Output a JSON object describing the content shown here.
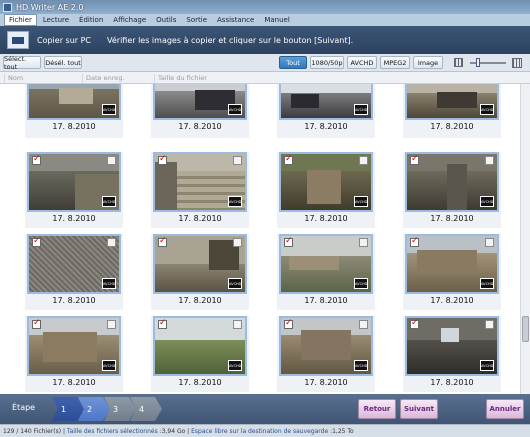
{
  "window": {
    "title": "HD Writer AE 2.0"
  },
  "menu": [
    "Fichier",
    "Lecture",
    "Édition",
    "Affichage",
    "Outils",
    "Sortie",
    "Assistance",
    "Manuel"
  ],
  "header": {
    "title": "Copier sur PC",
    "message": "Vérifier les images à copier et cliquer sur le bouton [Suivant]."
  },
  "toolbar": {
    "select_all": "Sélect. tout",
    "deselect_all": "Désél. tout",
    "filters": [
      "Tout",
      "1080/50p",
      "AVCHD",
      "MPEG2",
      "Image"
    ],
    "selected_filter": "Tout"
  },
  "columns": [
    "Nom",
    "Date enreg.",
    "Taille du fichier"
  ],
  "tiles": [
    {
      "date": "17. 8.2010",
      "checked": true,
      "badge": "AVCHD"
    },
    {
      "date": "17. 8.2010",
      "checked": true,
      "badge": "AVCHD"
    },
    {
      "date": "17. 8.2010",
      "checked": true,
      "badge": "AVCHD"
    },
    {
      "date": "17. 8.2010",
      "checked": true,
      "badge": "AVCHD"
    },
    {
      "date": "17. 8.2010",
      "checked": true,
      "badge": "AVCHD"
    },
    {
      "date": "17. 8.2010",
      "checked": true,
      "badge": "AVCHD"
    },
    {
      "date": "17. 8.2010",
      "checked": true,
      "badge": "AVCHD"
    },
    {
      "date": "17. 8.2010",
      "checked": true,
      "badge": "AVCHD"
    },
    {
      "date": "17. 8.2010",
      "checked": true,
      "badge": "AVCHD"
    },
    {
      "date": "17. 8.2010",
      "checked": true,
      "badge": "AVCHD"
    },
    {
      "date": "17. 8.2010",
      "checked": true,
      "badge": "AVCHD"
    },
    {
      "date": "17. 8.2010",
      "checked": true,
      "badge": "AVCHD"
    },
    {
      "date": "17. 8.2010",
      "checked": true,
      "badge": "AVCHD"
    },
    {
      "date": "17. 8.2010",
      "checked": true,
      "badge": "AVCHD"
    },
    {
      "date": "17. 8.2010",
      "checked": true,
      "badge": "AVCHD"
    },
    {
      "date": "17. 8.2010",
      "checked": true,
      "badge": "AVCHD"
    }
  ],
  "steps": {
    "label": "Étape",
    "items": [
      "1",
      "2",
      "3",
      "4"
    ],
    "current": 2
  },
  "buttons": {
    "back": "Retour",
    "next": "Suivant",
    "cancel": "Annuler"
  },
  "status": {
    "count": "129 / 140 Fichier(s)",
    "size_label": "Taille des fichiers sélectionnés : ",
    "size_value": "3,94 Go",
    "free_label": "Espace libre sur la destination de sauvegarde : ",
    "free_value": "1,25 To"
  },
  "colors": {
    "header_bg": "#2c4260",
    "selected_filter": "#2f79c0",
    "check": "#dd0000",
    "action_button": "#dbb8db"
  }
}
